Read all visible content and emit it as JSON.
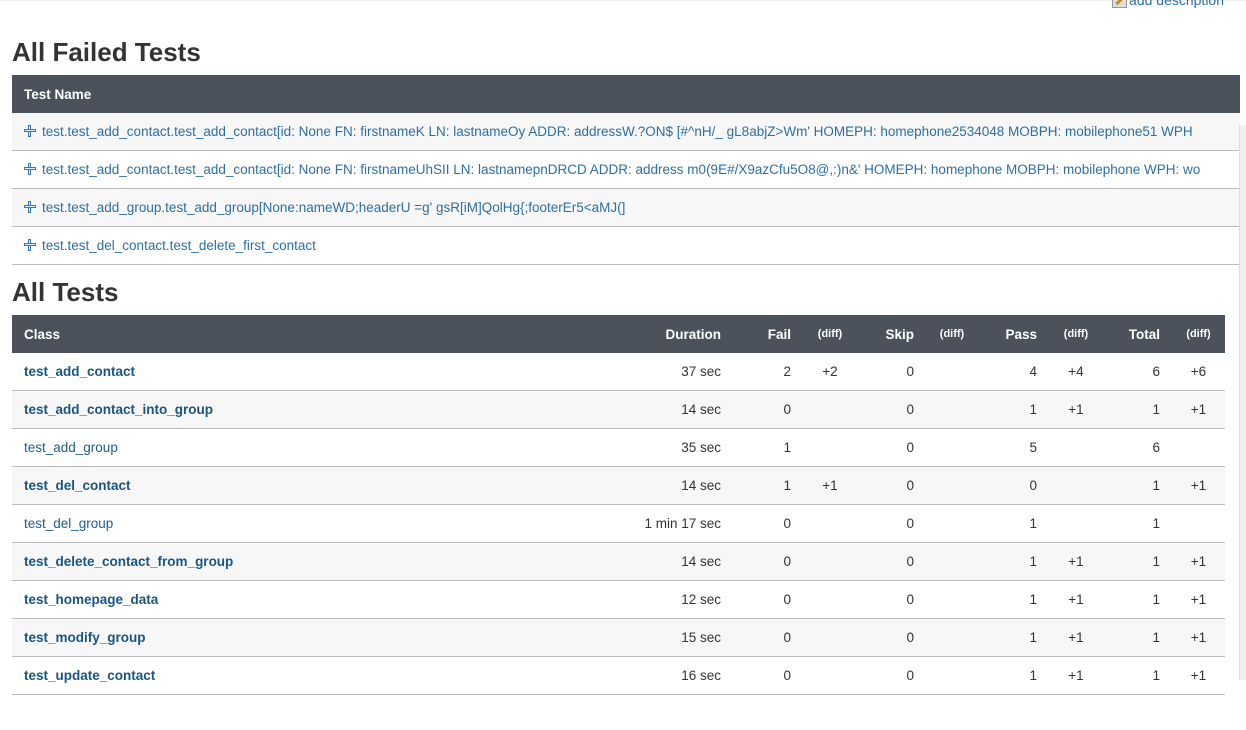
{
  "header": {
    "add_description": "add description"
  },
  "failed_section": {
    "title": "All Failed Tests",
    "column": "Test Name",
    "rows": [
      "test.test_add_contact.test_add_contact[id: None FN: firstnameK LN: lastnameOy ADDR: addressW.?ON$ [#^nH/_ gL8abjZ>Wm' HOMEPH: homephone2534048 MOBPH: mobilephone51 WPH",
      "test.test_add_contact.test_add_contact[id: None FN: firstnameUhSII LN: lastnamepnDRCD ADDR: address m0(9E#/X9azCfu5O8@,:)n&' HOMEPH: homephone MOBPH: mobilephone WPH: wo",
      "test.test_add_group.test_add_group[None:nameWD;headerU =g' gsR[iM]QolHg{;footerEr5<aMJ(]",
      "test.test_del_contact.test_delete_first_contact"
    ]
  },
  "all_section": {
    "title": "All Tests",
    "columns": {
      "class": "Class",
      "duration": "Duration",
      "fail": "Fail",
      "diff": "(diff)",
      "skip": "Skip",
      "pass": "Pass",
      "total": "Total"
    },
    "rows": [
      {
        "class": "test_add_contact",
        "bold": true,
        "duration": "37 sec",
        "fail": "2",
        "fail_diff": "+2",
        "skip": "0",
        "skip_diff": "",
        "pass": "4",
        "pass_diff": "+4",
        "total": "6",
        "total_diff": "+6"
      },
      {
        "class": "test_add_contact_into_group",
        "bold": true,
        "duration": "14 sec",
        "fail": "0",
        "fail_diff": "",
        "skip": "0",
        "skip_diff": "",
        "pass": "1",
        "pass_diff": "+1",
        "total": "1",
        "total_diff": "+1"
      },
      {
        "class": "test_add_group",
        "bold": false,
        "duration": "35 sec",
        "fail": "1",
        "fail_diff": "",
        "skip": "0",
        "skip_diff": "",
        "pass": "5",
        "pass_diff": "",
        "total": "6",
        "total_diff": ""
      },
      {
        "class": "test_del_contact",
        "bold": true,
        "duration": "14 sec",
        "fail": "1",
        "fail_diff": "+1",
        "skip": "0",
        "skip_diff": "",
        "pass": "0",
        "pass_diff": "",
        "total": "1",
        "total_diff": "+1"
      },
      {
        "class": "test_del_group",
        "bold": false,
        "duration": "1 min 17 sec",
        "fail": "0",
        "fail_diff": "",
        "skip": "0",
        "skip_diff": "",
        "pass": "1",
        "pass_diff": "",
        "total": "1",
        "total_diff": ""
      },
      {
        "class": "test_delete_contact_from_group",
        "bold": true,
        "duration": "14 sec",
        "fail": "0",
        "fail_diff": "",
        "skip": "0",
        "skip_diff": "",
        "pass": "1",
        "pass_diff": "+1",
        "total": "1",
        "total_diff": "+1"
      },
      {
        "class": "test_homepage_data",
        "bold": true,
        "duration": "12 sec",
        "fail": "0",
        "fail_diff": "",
        "skip": "0",
        "skip_diff": "",
        "pass": "1",
        "pass_diff": "+1",
        "total": "1",
        "total_diff": "+1"
      },
      {
        "class": "test_modify_group",
        "bold": true,
        "duration": "15 sec",
        "fail": "0",
        "fail_diff": "",
        "skip": "0",
        "skip_diff": "",
        "pass": "1",
        "pass_diff": "+1",
        "total": "1",
        "total_diff": "+1"
      },
      {
        "class": "test_update_contact",
        "bold": true,
        "duration": "16 sec",
        "fail": "0",
        "fail_diff": "",
        "skip": "0",
        "skip_diff": "",
        "pass": "1",
        "pass_diff": "+1",
        "total": "1",
        "total_diff": "+1"
      }
    ]
  }
}
